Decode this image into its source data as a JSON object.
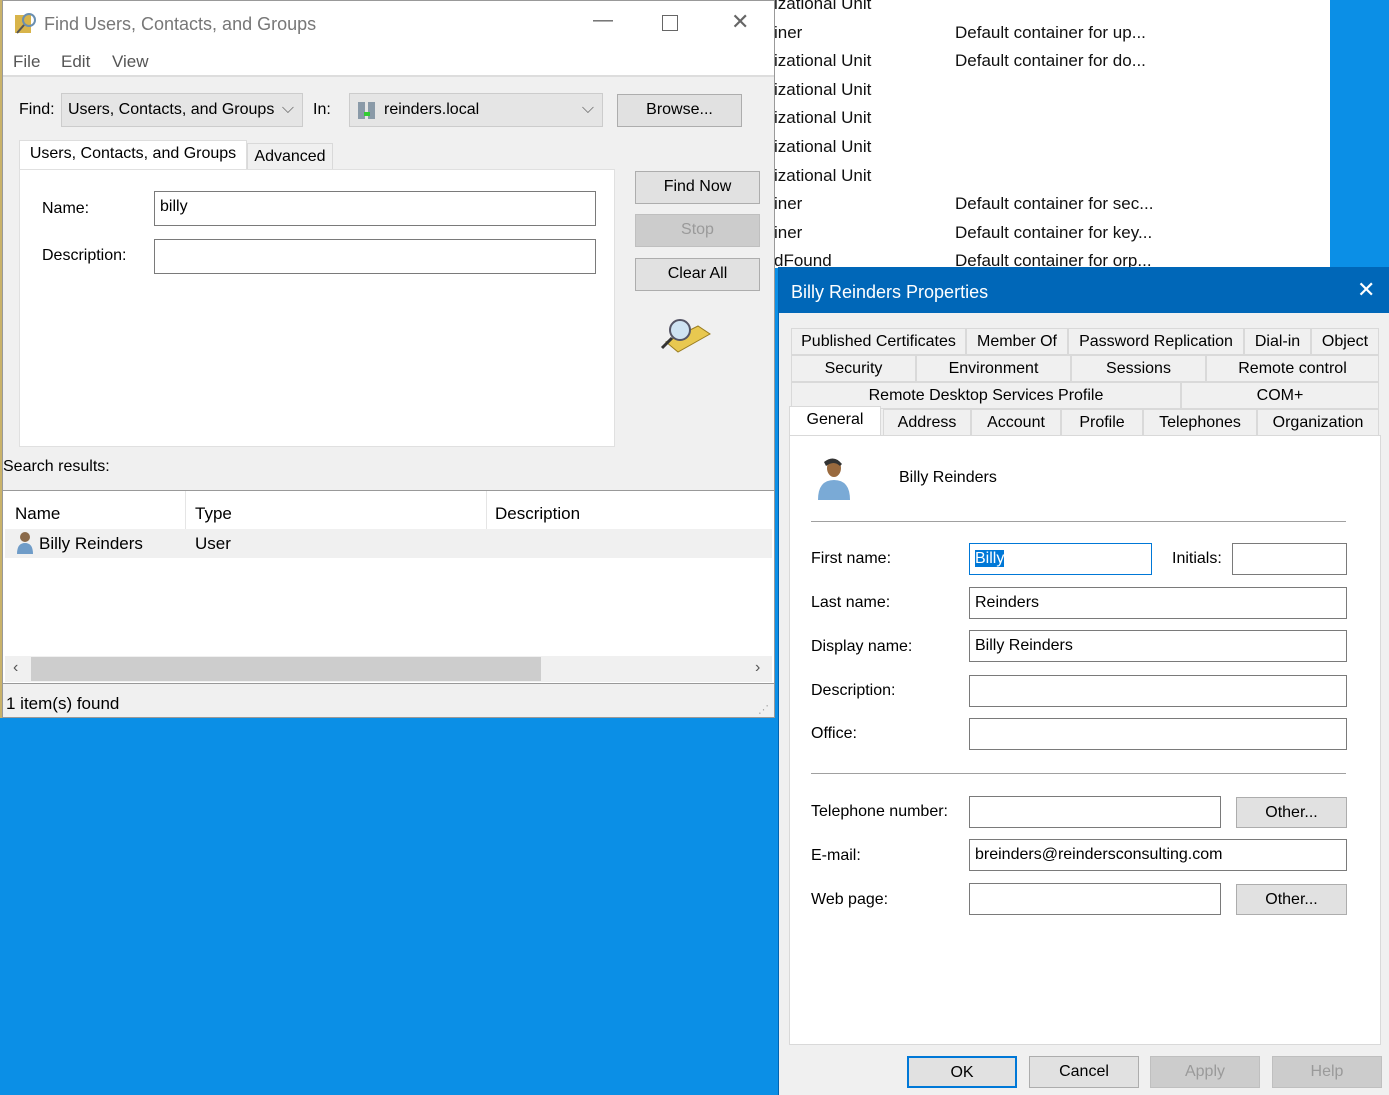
{
  "background_window": {
    "rows": [
      {
        "type": "izational Unit",
        "desc": ""
      },
      {
        "type": "iner",
        "desc": "Default container for up..."
      },
      {
        "type": "izational Unit",
        "desc": "Default container for do..."
      },
      {
        "type": "izational Unit",
        "desc": ""
      },
      {
        "type": "izational Unit",
        "desc": ""
      },
      {
        "type": "izational Unit",
        "desc": ""
      },
      {
        "type": "izational Unit",
        "desc": ""
      },
      {
        "type": "iner",
        "desc": "Default container for sec..."
      },
      {
        "type": "iner",
        "desc": "Default container for key..."
      },
      {
        "type": "dFound",
        "desc": "Default container for orp..."
      }
    ]
  },
  "find_dialog": {
    "title": "Find Users, Contacts, and Groups",
    "menu": [
      "File",
      "Edit",
      "View"
    ],
    "find_label": "Find:",
    "find_value": "Users, Contacts, and Groups",
    "in_label": "In:",
    "in_value": "reinders.local",
    "browse": "Browse...",
    "tabs": [
      "Users, Contacts, and Groups",
      "Advanced"
    ],
    "name_label": "Name:",
    "name_value": "billy",
    "desc_label": "Description:",
    "desc_value": "",
    "find_now": "Find Now",
    "stop": "Stop",
    "clear_all": "Clear All",
    "results_label": "Search results:",
    "columns": [
      "Name",
      "Type",
      "Description"
    ],
    "results": [
      {
        "name": "Billy Reinders",
        "type": "User",
        "description": ""
      }
    ],
    "status": "1 item(s) found"
  },
  "props_dialog": {
    "title": "Billy Reinders Properties",
    "tab_rows": [
      [
        "Published Certificates",
        "Member Of",
        "Password Replication",
        "Dial-in",
        "Object"
      ],
      [
        "Security",
        "Environment",
        "Sessions",
        "Remote control"
      ],
      [
        "Remote Desktop Services Profile",
        "COM+"
      ],
      [
        "General",
        "Address",
        "Account",
        "Profile",
        "Telephones",
        "Organization"
      ]
    ],
    "active_tab": "General",
    "display_header": "Billy Reinders",
    "fields": {
      "first_name_label": "First name:",
      "first_name": "Billy",
      "initials_label": "Initials:",
      "initials": "",
      "last_name_label": "Last name:",
      "last_name": "Reinders",
      "display_name_label": "Display name:",
      "display_name": "Billy Reinders",
      "description_label": "Description:",
      "description": "",
      "office_label": "Office:",
      "office": "",
      "telephone_label": "Telephone number:",
      "telephone": "",
      "email_label": "E-mail:",
      "email": "breinders@reindersconsulting.com",
      "webpage_label": "Web page:",
      "webpage": ""
    },
    "other": "Other...",
    "buttons": {
      "ok": "OK",
      "cancel": "Cancel",
      "apply": "Apply",
      "help": "Help"
    }
  },
  "colors": {
    "desktop": "#0b8fe6",
    "title_accent": "#0067b8"
  }
}
